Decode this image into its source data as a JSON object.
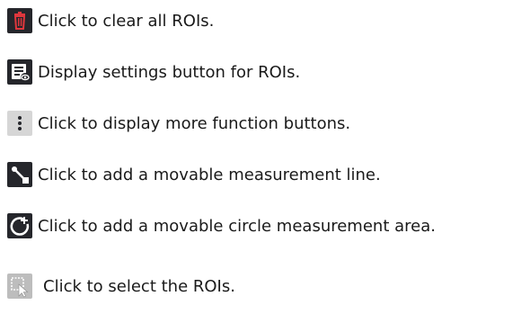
{
  "items": [
    {
      "icon": "trash-icon",
      "text": "Click to clear all ROIs."
    },
    {
      "icon": "display-settings-icon",
      "text": "Display settings button for ROIs."
    },
    {
      "icon": "more-vertical-icon",
      "text": "Click to display more function buttons."
    },
    {
      "icon": "measurement-line-icon",
      "text": "Click to add a movable measurement line."
    },
    {
      "icon": "circle-measurement-icon",
      "text": "Click to add a movable circle measurement area."
    },
    {
      "icon": "select-roi-icon",
      "text": "Click to select the ROIs."
    }
  ],
  "colors": {
    "icon_dark_bg": "#25262b",
    "icon_red": "#e0373d",
    "icon_grey": "#d6d6d6",
    "text": "#1a1a1a"
  }
}
